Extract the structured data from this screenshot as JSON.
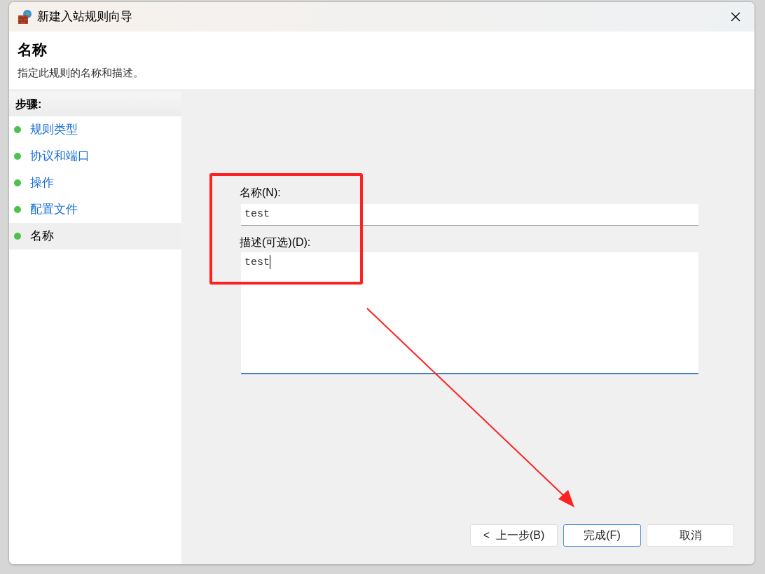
{
  "window": {
    "title": "新建入站规则向导"
  },
  "header": {
    "title": "名称",
    "subtitle": "指定此规则的名称和描述。"
  },
  "steps": {
    "heading": "步骤:",
    "items": [
      {
        "label": "规则类型",
        "selected": false
      },
      {
        "label": "协议和端口",
        "selected": false
      },
      {
        "label": "操作",
        "selected": false
      },
      {
        "label": "配置文件",
        "selected": false
      },
      {
        "label": "名称",
        "selected": true
      }
    ]
  },
  "form": {
    "name_label": "名称(N):",
    "name_value": "test",
    "description_label": "描述(可选)(D):",
    "description_value": "test"
  },
  "buttons": [
    {
      "label": "<  上一步(B)",
      "default": false
    },
    {
      "label": "完成(F)",
      "default": true
    },
    {
      "label": "取消",
      "default": false
    }
  ]
}
